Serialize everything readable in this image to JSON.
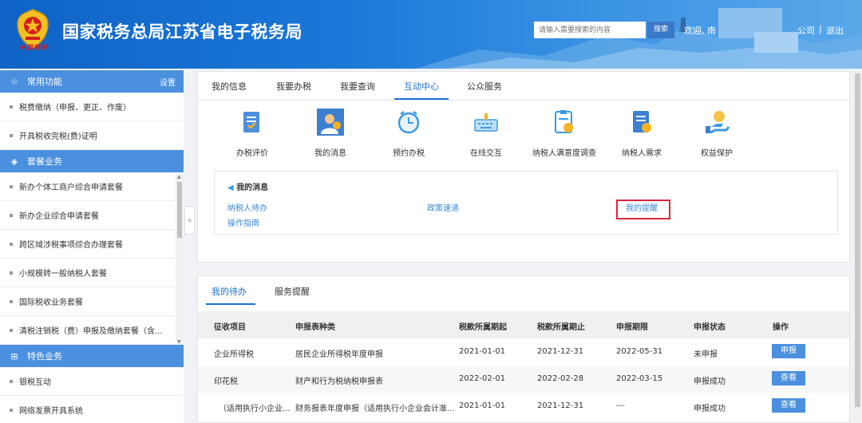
{
  "header": {
    "site_title": "国家税务总局江苏省电子税务局",
    "logo_script": "中国税务",
    "search_placeholder": "请输入需要搜索的内容",
    "search_button": "搜索",
    "welcome": "欢迎, 南",
    "company": "公司",
    "separator": "|",
    "logout": "退出"
  },
  "sidebar": {
    "sections": [
      {
        "title": "常用功能",
        "icon": "star-icon",
        "setting": "设置"
      },
      {
        "title": "套餐业务",
        "icon": "package-icon"
      },
      {
        "title": "特色业务",
        "icon": "grid-icon"
      }
    ],
    "common_items": [
      "税费缴纳（申报、更正、作废）",
      "开具税收完税(费)证明"
    ],
    "package_items": [
      "新办个体工商户综合申请套餐",
      "新办企业综合申请套餐",
      "跨区域涉税事项综合办理套餐",
      "小规模转一般纳税人套餐",
      "国际税收业务套餐",
      "清税注销税（费）申报及缴纳套餐（含..."
    ],
    "special_items": [
      "银税互动",
      "网络发票开具系统"
    ]
  },
  "main_tabs": [
    "我的信息",
    "我要办税",
    "我要查询",
    "互动中心",
    "公众服务"
  ],
  "active_tab": "互动中心",
  "icons": [
    {
      "label": "办税评价",
      "icon": "evaluation-icon"
    },
    {
      "label": "我的消息",
      "icon": "message-icon"
    },
    {
      "label": "预约办税",
      "icon": "clock-icon"
    },
    {
      "label": "在线交互",
      "icon": "keyboard-icon"
    },
    {
      "label": "纳税人满意度调查",
      "icon": "survey-icon"
    },
    {
      "label": "纳税人需求",
      "icon": "demand-icon"
    },
    {
      "label": "权益保护",
      "icon": "protection-icon"
    }
  ],
  "messages": {
    "title": "我的消息",
    "links": [
      "纳税人待办",
      "政策速递",
      "我的提醒",
      "操作指南"
    ]
  },
  "todo": {
    "tabs": [
      "我的待办",
      "服务提醒"
    ],
    "columns": [
      "征收项目",
      "申报表种类",
      "税款所属期起",
      "税款所属期止",
      "申报期限",
      "申报状态",
      "操作"
    ],
    "rows": [
      {
        "item": "企业所得税",
        "form": "居民企业所得税年度申报",
        "start": "2021-01-01",
        "end": "2021-12-31",
        "deadline": "2022-05-31",
        "status": "未申报",
        "action": "申报"
      },
      {
        "item": "印花税",
        "form": "财产和行为税纳税申报表",
        "start": "2022-02-01",
        "end": "2022-02-28",
        "deadline": "2022-03-15",
        "status": "申报成功",
        "action": "查看"
      },
      {
        "item": "（适用执行小企业...",
        "form": "财务报表年度申报（适用执行小企业会计准...",
        "start": "2021-01-01",
        "end": "2021-12-31",
        "deadline": "---",
        "status": "申报成功",
        "action": "查看"
      }
    ]
  },
  "colors": {
    "header_blue": "#1b78d8",
    "accent": "#1e6fd0",
    "link": "#3b8ad8",
    "highlight": "#d8263a",
    "sidebar_head": "#4a90de"
  }
}
